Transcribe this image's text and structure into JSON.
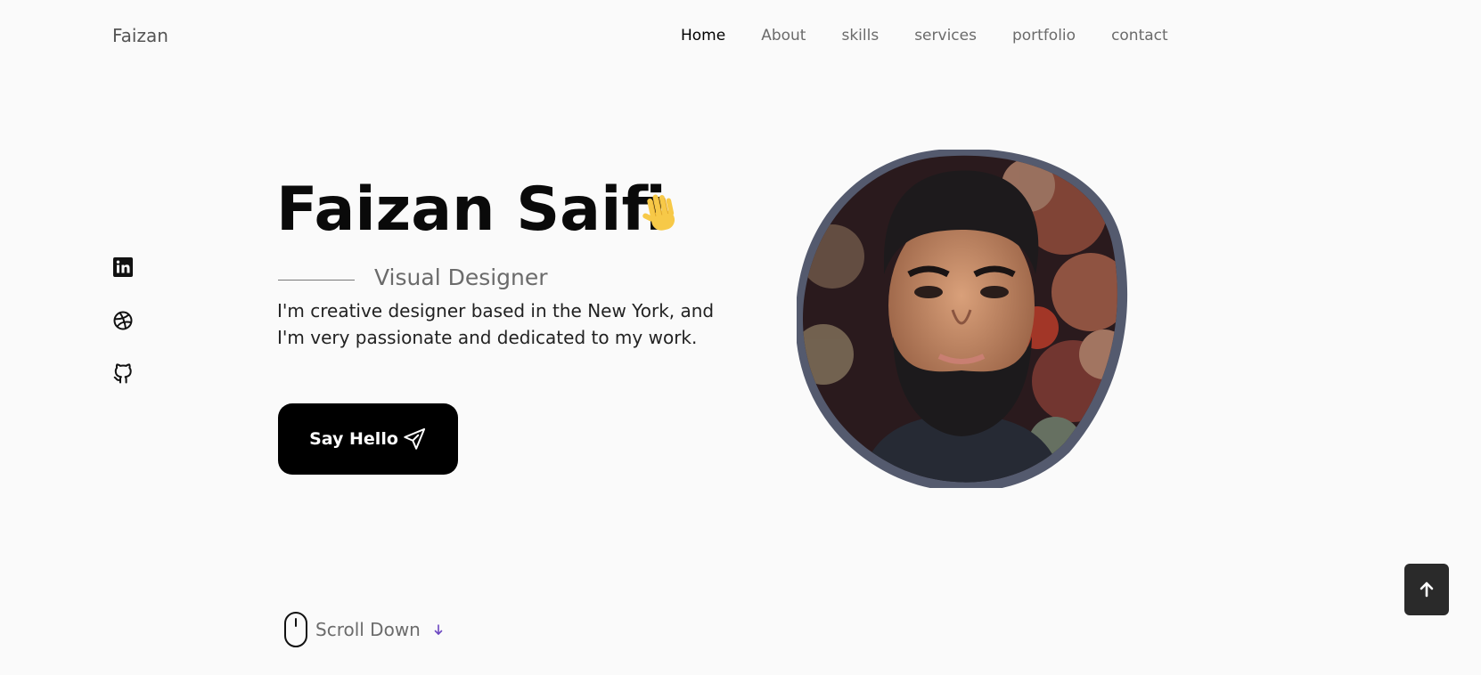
{
  "header": {
    "logo": "Faizan",
    "nav": [
      {
        "label": "Home",
        "active": true
      },
      {
        "label": "About",
        "active": false
      },
      {
        "label": "skills",
        "active": false
      },
      {
        "label": "services",
        "active": false
      },
      {
        "label": "portfolio",
        "active": false
      },
      {
        "label": "contact",
        "active": false
      }
    ]
  },
  "social": {
    "icons": [
      "linkedin-icon",
      "dribbble-icon",
      "github-icon"
    ]
  },
  "hero": {
    "name": "Faizan Saifi",
    "wave_icon": "waving-hand-icon",
    "subtitle": "Visual Designer",
    "description": "I'm creative designer based in the New York, and I'm very passionate and dedicated to my work.",
    "cta_label": "Say Hello",
    "cta_icon": "send-icon"
  },
  "scroll": {
    "label": "Scroll Down",
    "icon": "mouse-icon",
    "arrow_icon": "arrow-down-icon"
  },
  "to_top": {
    "icon": "arrow-up-icon"
  },
  "colors": {
    "background": "#fafafa",
    "text": "#000000",
    "muted": "#6b6b6b",
    "button": "#000000",
    "to_top_bg": "#2a2a2a",
    "profile_border": "#545a6e"
  }
}
